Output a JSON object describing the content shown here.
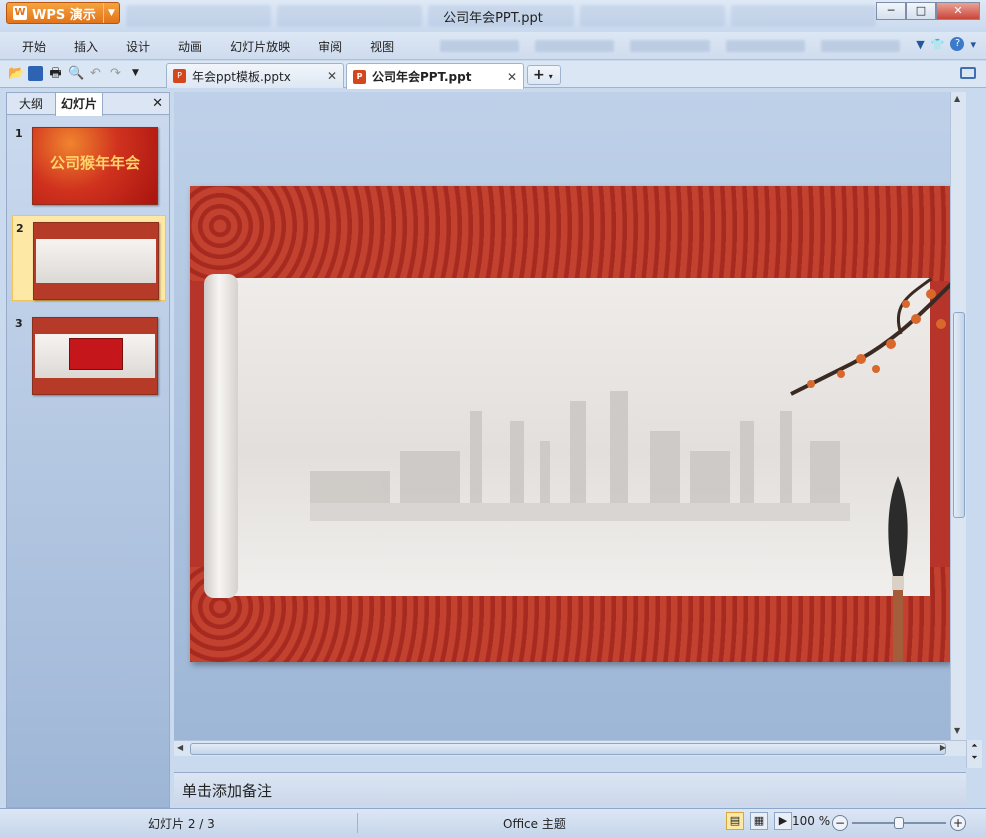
{
  "window": {
    "title": "公司年会PPT.ppt"
  },
  "app_button": {
    "label": "WPS 演示"
  },
  "menu": [
    "开始",
    "插入",
    "设计",
    "动画",
    "幻灯片放映",
    "审阅",
    "视图"
  ],
  "tabs": [
    {
      "label": "年会ppt模板.pptx",
      "active": false
    },
    {
      "label": "公司年会PPT.ppt",
      "active": true
    }
  ],
  "left_panel": {
    "tabs": [
      "大纲",
      "幻灯片"
    ],
    "slides": [
      {
        "num": "1",
        "text": "公司猴年年会"
      },
      {
        "num": "2",
        "text": ""
      },
      {
        "num": "3",
        "text": ""
      }
    ]
  },
  "notes": {
    "placeholder": "单击添加备注"
  },
  "status": {
    "slide_info": "幻灯片 2 / 3",
    "theme": "Office 主题",
    "zoom": "100 %"
  }
}
